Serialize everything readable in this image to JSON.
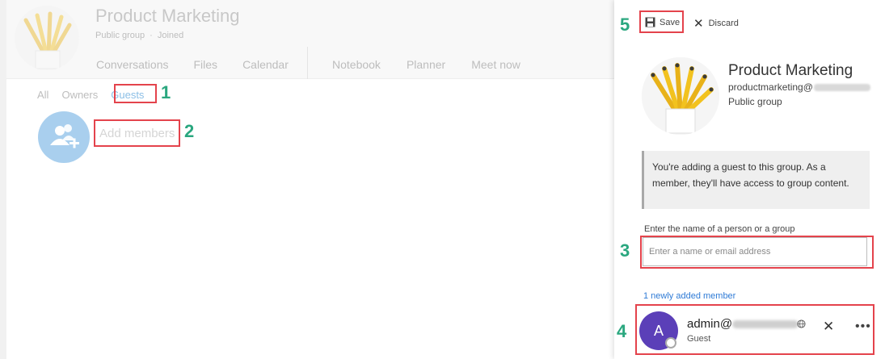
{
  "group": {
    "name": "Product Marketing",
    "visibility": "Public group",
    "membership": "Joined",
    "email_prefix": "productmarketing@"
  },
  "nav": {
    "tabs": [
      "Conversations",
      "Files",
      "Calendar"
    ],
    "tabs2": [
      "Notebook",
      "Planner",
      "Meet now"
    ]
  },
  "filters": {
    "all": "All",
    "owners": "Owners",
    "guests": "Guests"
  },
  "add_members": "Add members",
  "panel": {
    "save_label": "Save",
    "discard_label": "Discard",
    "notice": "You're adding a guest to this group. As a member, they'll have access to group content.",
    "field_label": "Enter the name of a person or a group",
    "field_placeholder": "Enter a name or email address",
    "newly_added": "1 newly added member",
    "member": {
      "initial": "A",
      "name_prefix": "admin@",
      "role": "Guest"
    }
  },
  "callouts": [
    "1",
    "2",
    "3",
    "4",
    "5"
  ],
  "colors": {
    "accent": "#2f7bd6",
    "callout_box": "#e4434c",
    "callout_number": "#2aa77f",
    "member_avatar": "#5b3fb8"
  },
  "icons": {
    "save": "floppy-disk-icon",
    "discard": "close-icon",
    "add_members": "add-people-icon",
    "guest": "globe-icon",
    "remove": "close-icon",
    "more": "ellipsis-icon"
  }
}
